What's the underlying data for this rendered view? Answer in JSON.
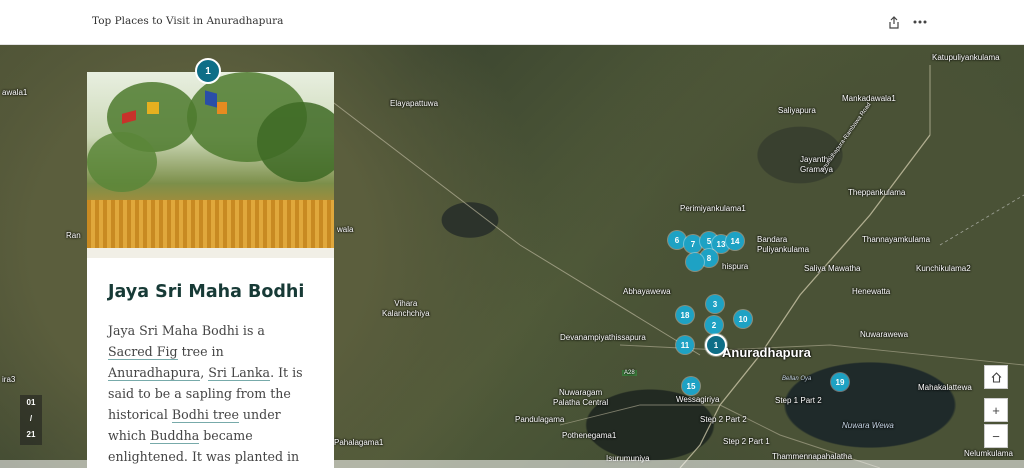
{
  "header": {
    "title": "Top Places to Visit in Anuradhapura",
    "share_icon": "share-icon",
    "more_icon": "more-options-icon"
  },
  "card": {
    "marker": "1",
    "heading": "Jaya Sri Maha Bodhi",
    "p": {
      "t1": "Jaya Sri Maha Bodhi is a ",
      "l1": "Sacred Fig",
      "t2": " tree in ",
      "l2": "Anuradhapura",
      "t3": ", ",
      "l3": "Sri Lanka",
      "t4": ". It is said to be a sapling from the historical ",
      "l4": "Bodhi tree",
      "t5": " under which ",
      "l5": "Buddha",
      "t6": " became enlightened. It was planted in"
    }
  },
  "side_nav": {
    "current": "01",
    "sep": "/",
    "total": "21"
  },
  "controls": {
    "home_icon": "home-icon",
    "zoom_in": "+",
    "zoom_out": "−"
  },
  "map": {
    "labels": [
      {
        "key": "katupuliyankulama",
        "text": "Katupuliyankulama"
      },
      {
        "key": "mankadawala",
        "text": "Mankadawala1"
      },
      {
        "key": "elayapattuwa",
        "text": "Elayapattuwa"
      },
      {
        "key": "saliyapura",
        "text": "Saliyapura"
      },
      {
        "key": "jayanthi",
        "text": "Jayanthi\nGramaya"
      },
      {
        "key": "theppankulama",
        "text": "Theppankulama"
      },
      {
        "key": "perimiyankulama",
        "text": "Perimiyankulama1"
      },
      {
        "key": "bandara",
        "text": "Bandara\nPuliyankulama"
      },
      {
        "key": "thannayam",
        "text": "Thannayamkulama"
      },
      {
        "key": "saliya",
        "text": "Saliya Mawatha"
      },
      {
        "key": "kunchi",
        "text": "Kunchikulama2"
      },
      {
        "key": "abhaya",
        "text": "Abhayawewa"
      },
      {
        "key": "henewatta",
        "text": "Henewatta"
      },
      {
        "key": "vihara",
        "text": "Vihara\nKalanchchiya"
      },
      {
        "key": "devanam",
        "text": "Devanampiyathissapura"
      },
      {
        "key": "anuradhapura",
        "text": "Anuradhapura"
      },
      {
        "key": "nuwarawewa1",
        "text": "Nuwarawewa"
      },
      {
        "key": "mahakalattewa",
        "text": "Mahakalattewa"
      },
      {
        "key": "nuwaragam",
        "text": "Nuwaragam\nPalatha Central"
      },
      {
        "key": "wessagiriya",
        "text": "Wessagiriya"
      },
      {
        "key": "step1",
        "text": "Step 1 Part 2"
      },
      {
        "key": "pandulagama",
        "text": "Pandulagama"
      },
      {
        "key": "step2p2",
        "text": "Step 2 Part 2"
      },
      {
        "key": "pothenegama",
        "text": "Pothenegama1"
      },
      {
        "key": "step2p1",
        "text": "Step 2 Part 1"
      },
      {
        "key": "nuwarawewa2",
        "text": "Nuwara Wewa"
      },
      {
        "key": "pahalagama",
        "text": "Pahalagama1"
      },
      {
        "key": "nelumkulama",
        "text": "Nelumkulama"
      },
      {
        "key": "isurumuniya",
        "text": "Isurumuniya"
      },
      {
        "key": "thammenna",
        "text": "Thammennapahalatha"
      },
      {
        "key": "wala",
        "text": "wala"
      },
      {
        "key": "ran",
        "text": "Ran"
      },
      {
        "key": "awala",
        "text": "awala1"
      },
      {
        "key": "ira",
        "text": "ira3"
      },
      {
        "key": "road",
        "text": "Anuradhapura-Rambawa Road"
      },
      {
        "key": "bellanoya",
        "text": "Bellan Oya"
      },
      {
        "key": "a28",
        "text": "A28"
      },
      {
        "key": "ospura",
        "text": "hispura"
      }
    ],
    "markers": [
      "1",
      "2",
      "3",
      "5",
      "6",
      "7",
      "8",
      "10",
      "11",
      "13",
      "14",
      "15",
      "18",
      "19"
    ]
  }
}
